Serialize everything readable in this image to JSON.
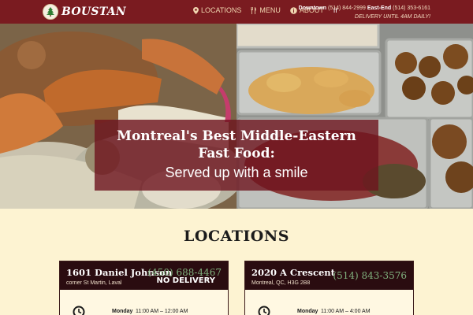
{
  "header": {
    "brand": "BOUSTAN",
    "nav": [
      {
        "label": "LOCATIONS",
        "icon": "map-pin-icon"
      },
      {
        "label": "MENU",
        "icon": "fork-knife-icon"
      },
      {
        "label": "ABOUT",
        "icon": "info-icon"
      }
    ],
    "language": "fr",
    "contact": {
      "downtown_label": "Downtown",
      "downtown_phone": "(514) 844-2999",
      "eastend_label": "East-End",
      "eastend_phone": "(514) 353-6161",
      "delivery": "DELIVERY UNTIL 4AM DAILY!"
    },
    "colors": {
      "bar": "#7a1b20"
    }
  },
  "hero": {
    "title_line1": "Montreal's Best Middle-Eastern",
    "title_line2": "Fast Food:",
    "subtitle": "Served up with a smile"
  },
  "locations": {
    "heading": "LOCATIONS",
    "cards": [
      {
        "name": "1601 Daniel Johnson",
        "address": "corner St Martin, Laval",
        "phone": "(450) 688-4467",
        "note": "NO DELIVERY",
        "day": "Monday",
        "hours": "11:00 AM – 12:00 AM"
      },
      {
        "name": "2020 A Crescent",
        "address": "Montreal, QC, H3G 2B8",
        "phone": "(514) 843-3576",
        "note": "",
        "day": "Monday",
        "hours": "11:00 AM – 4:00 AM"
      }
    ]
  }
}
